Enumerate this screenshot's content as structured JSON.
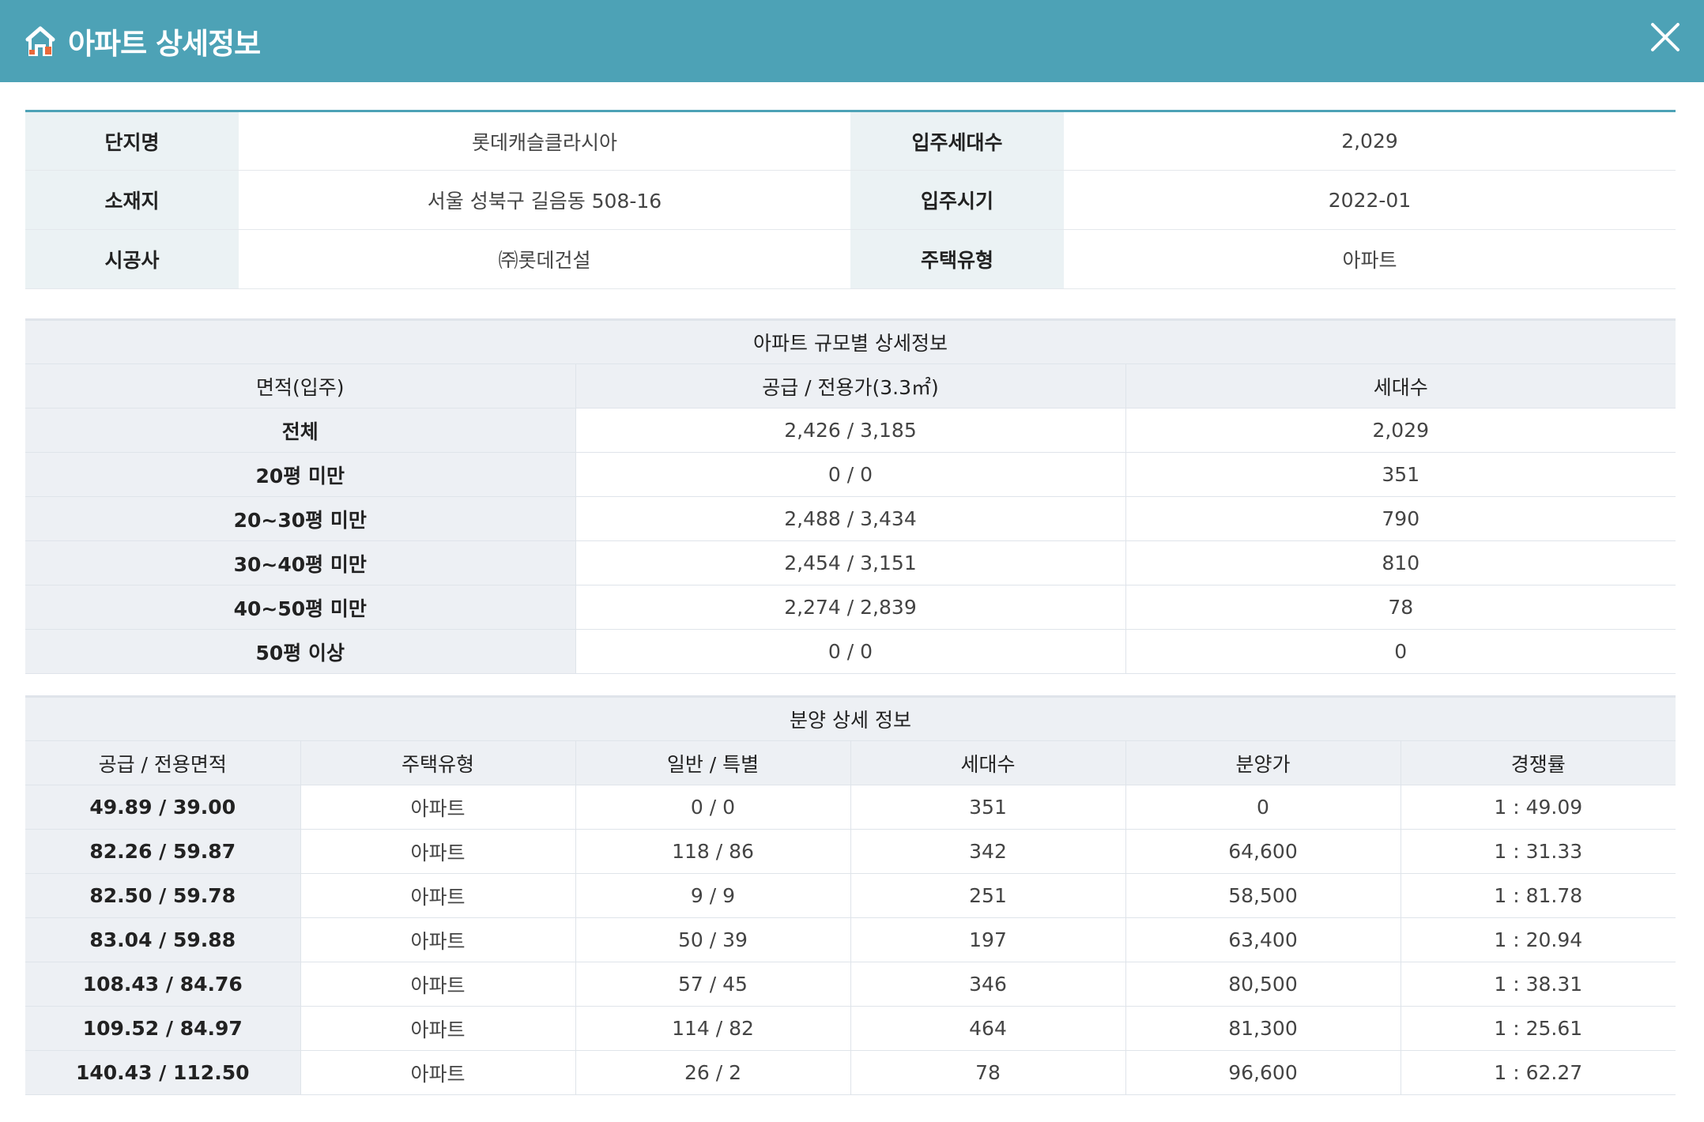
{
  "header": {
    "title": "아파트 상세정보",
    "accent_color": "#4da2b6",
    "logo_icon": "house-icon",
    "close_icon": "close-icon"
  },
  "info": {
    "rows": [
      [
        {
          "label": "단지명",
          "value": "롯데캐슬클라시아"
        },
        {
          "label": "입주세대수",
          "value": "2,029"
        }
      ],
      [
        {
          "label": "소재지",
          "value": "서울 성북구 길음동 508-16"
        },
        {
          "label": "입주시기",
          "value": "2022-01"
        }
      ],
      [
        {
          "label": "시공사",
          "value": "㈜롯데건설"
        },
        {
          "label": "주택유형",
          "value": "아파트"
        }
      ]
    ]
  },
  "size_table": {
    "caption": "아파트 규모별 상세정보",
    "headers": [
      "면적(입주)",
      "공급 / 전용가(3.3㎡)",
      "세대수"
    ],
    "rows": [
      [
        "전체",
        "2,426 / 3,185",
        "2,029"
      ],
      [
        "20평 미만",
        "0 / 0",
        "351"
      ],
      [
        "20~30평 미만",
        "2,488 / 3,434",
        "790"
      ],
      [
        "30~40평 미만",
        "2,454 / 3,151",
        "810"
      ],
      [
        "40~50평 미만",
        "2,274 / 2,839",
        "78"
      ],
      [
        "50평 이상",
        "0 / 0",
        "0"
      ]
    ]
  },
  "sale_table": {
    "caption": "분양 상세 정보",
    "headers": [
      "공급 / 전용면적",
      "주택유형",
      "일반 / 특별",
      "세대수",
      "분양가",
      "경쟁률"
    ],
    "rows": [
      [
        "49.89 / 39.00",
        "아파트",
        "0 / 0",
        "351",
        "0",
        "1 : 49.09"
      ],
      [
        "82.26 / 59.87",
        "아파트",
        "118 / 86",
        "342",
        "64,600",
        "1 : 31.33"
      ],
      [
        "82.50 / 59.78",
        "아파트",
        "9 / 9",
        "251",
        "58,500",
        "1 : 81.78"
      ],
      [
        "83.04 / 59.88",
        "아파트",
        "50 / 39",
        "197",
        "63,400",
        "1 : 20.94"
      ],
      [
        "108.43 / 84.76",
        "아파트",
        "57 / 45",
        "346",
        "80,500",
        "1 : 38.31"
      ],
      [
        "109.52 / 84.97",
        "아파트",
        "114 / 82",
        "464",
        "81,300",
        "1 : 25.61"
      ],
      [
        "140.43 / 112.50",
        "아파트",
        "26 / 2",
        "78",
        "96,600",
        "1 : 62.27"
      ]
    ]
  }
}
